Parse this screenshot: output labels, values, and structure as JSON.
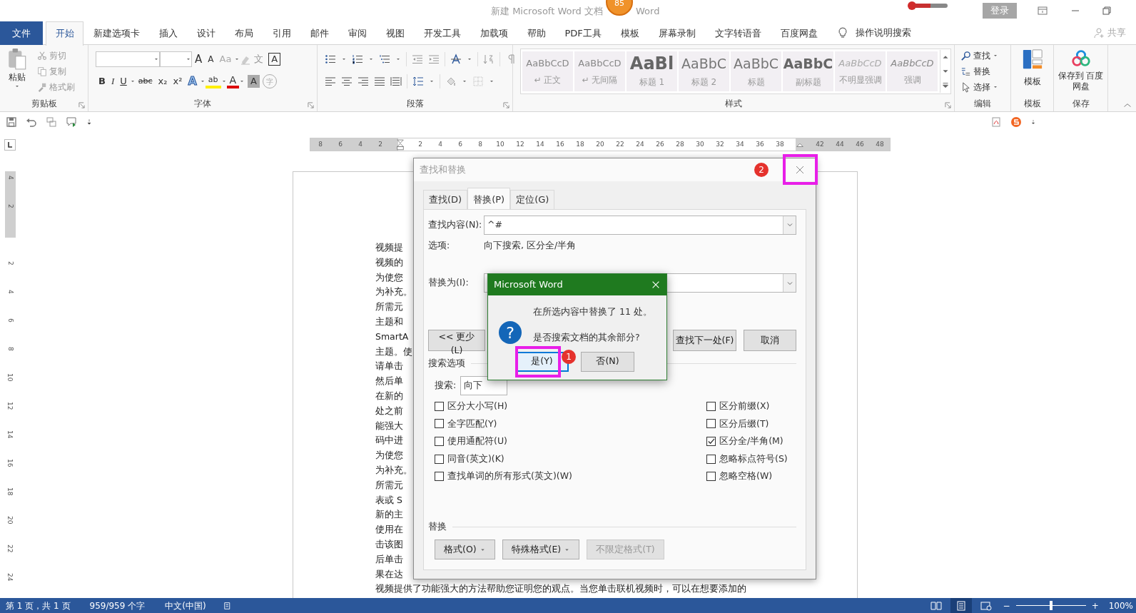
{
  "title_bar": {
    "title_left": "新建 Microsoft Word 文档",
    "badge": "85",
    "title_right": "Word",
    "login": "登录"
  },
  "ribbon_tabs": [
    {
      "label": "文件",
      "kind": "file",
      "selected": false
    },
    {
      "label": "开始",
      "kind": "tab",
      "selected": true
    },
    {
      "label": "新建选项卡",
      "kind": "tab",
      "selected": false
    },
    {
      "label": "插入",
      "kind": "tab",
      "selected": false
    },
    {
      "label": "设计",
      "kind": "tab",
      "selected": false
    },
    {
      "label": "布局",
      "kind": "tab",
      "selected": false
    },
    {
      "label": "引用",
      "kind": "tab",
      "selected": false
    },
    {
      "label": "邮件",
      "kind": "tab",
      "selected": false
    },
    {
      "label": "审阅",
      "kind": "tab",
      "selected": false
    },
    {
      "label": "视图",
      "kind": "tab",
      "selected": false
    },
    {
      "label": "开发工具",
      "kind": "tab",
      "selected": false
    },
    {
      "label": "加载项",
      "kind": "tab",
      "selected": false
    },
    {
      "label": "帮助",
      "kind": "tab",
      "selected": false
    },
    {
      "label": "PDF工具",
      "kind": "tab",
      "selected": false
    },
    {
      "label": "模板",
      "kind": "tab",
      "selected": false
    },
    {
      "label": "屏幕录制",
      "kind": "tab",
      "selected": false
    },
    {
      "label": "文字转语音",
      "kind": "tab",
      "selected": false
    },
    {
      "label": "百度网盘",
      "kind": "tab",
      "selected": false
    }
  ],
  "tell_me": "操作说明搜索",
  "share": "共享",
  "clipboard": {
    "title": "剪贴板",
    "paste": "粘贴",
    "items": [
      "剪切",
      "复制",
      "格式刷"
    ]
  },
  "font": {
    "title": "字体",
    "row1": [
      "A",
      "A",
      "Aa",
      "文",
      "A"
    ],
    "row2": [
      "B",
      "I",
      "U",
      "abc",
      "x₂",
      "x²",
      "A",
      "ab",
      "A",
      "A",
      "字"
    ]
  },
  "paragraph": {
    "title": "段落"
  },
  "styles": {
    "title": "样式",
    "items": [
      {
        "preview": "AaBbCcD",
        "label": "↵ 正文"
      },
      {
        "preview": "AaBbCcD",
        "label": "↵ 无间隔"
      },
      {
        "preview": "AaBl",
        "label": "标题 1"
      },
      {
        "preview": "AaBbC",
        "label": "标题 2"
      },
      {
        "preview": "AaBbC",
        "label": "标题"
      },
      {
        "preview": "AaBbC",
        "label": "副标题"
      },
      {
        "preview": "AaBbCcD",
        "label": "不明显强调"
      },
      {
        "preview": "AaBbCcD",
        "label": "强调"
      }
    ]
  },
  "editing": {
    "title": "编辑",
    "items": [
      "查找",
      "替换",
      "选择"
    ]
  },
  "templates": {
    "title": "模板",
    "label": "模板"
  },
  "save": {
    "title": "保存",
    "label": "保存到 百度网盘"
  },
  "ruler_numbers": [
    "8",
    "6",
    "4",
    "2",
    "2",
    "4",
    "6",
    "8",
    "10",
    "12",
    "14",
    "16",
    "18",
    "20",
    "22",
    "24",
    "26",
    "28",
    "30",
    "32",
    "34",
    "36",
    "38",
    "42",
    "44",
    "46",
    "48"
  ],
  "vruler_numbers": [
    "4",
    "2",
    "2",
    "4",
    "6",
    "8",
    "10",
    "12",
    "14",
    "16",
    "18",
    "20",
    "22",
    "24"
  ],
  "document": {
    "lines": [
      "视频提",
      "视频的",
      "为使您",
      "为补充。",
      "所需元",
      "主题和",
      "SmartA",
      "主题。使",
      "请单击",
      "然后单",
      "在新的",
      "处之前",
      "能强大",
      "码中进",
      "为使您",
      "为补充。",
      "所需元",
      "表或 S",
      "新的主",
      "使用在",
      "击该图",
      "后单击",
      "果在达",
      "视频提供了功能强大的方法帮助您证明您的观点。当您单击联机视频时，可以在想要添加的"
    ]
  },
  "find_replace": {
    "title": "查找和替换",
    "tabs": [
      {
        "label": "查找(D)",
        "selected": false
      },
      {
        "label": "替换(P)",
        "selected": true
      },
      {
        "label": "定位(G)",
        "selected": false
      }
    ],
    "find_label": "查找内容(N):",
    "find_value": "^#",
    "options_label": "选项:",
    "options_value": "向下搜索, 区分全/半角",
    "replace_label": "替换为(I):",
    "buttons": [
      "<< 更少(L)",
      "查找下一处(F)",
      "取消"
    ],
    "search_options_title": "搜索选项",
    "search_label": "搜索:",
    "search_value": "向下",
    "checks_left": [
      {
        "label": "区分大小写(H)",
        "checked": false
      },
      {
        "label": "全字匹配(Y)",
        "checked": false
      },
      {
        "label": "使用通配符(U)",
        "checked": false
      },
      {
        "label": "同音(英文)(K)",
        "checked": false
      },
      {
        "label": "查找单词的所有形式(英文)(W)",
        "checked": false
      }
    ],
    "checks_right": [
      {
        "label": "区分前缀(X)",
        "checked": false
      },
      {
        "label": "区分后缀(T)",
        "checked": false
      },
      {
        "label": "区分全/半角(M)",
        "checked": true
      },
      {
        "label": "忽略标点符号(S)",
        "checked": false
      },
      {
        "label": "忽略空格(W)",
        "checked": false
      }
    ],
    "replace_section": "替换",
    "format_buttons": [
      {
        "label": "格式(O)",
        "dropdown": true,
        "disabled": false
      },
      {
        "label": "特殊格式(E)",
        "dropdown": true,
        "disabled": false
      },
      {
        "label": "不限定格式(T)",
        "dropdown": false,
        "disabled": true
      }
    ]
  },
  "message_box": {
    "title": "Microsoft Word",
    "icon": "?",
    "lines": [
      "在所选内容中替换了 11 处。",
      "是否搜索文档的其余部分?"
    ],
    "buttons": [
      {
        "label": "是(Y)",
        "selected": true
      },
      {
        "label": "否(N)",
        "selected": false
      }
    ]
  },
  "callouts": [
    "1",
    "2"
  ],
  "status_bar": {
    "items": [
      "第 1 页，共 1 页",
      "959/959 个字",
      "中文(中国)"
    ],
    "zoom": "100%",
    "zoom_out": "−",
    "zoom_in": "+",
    "zoom_level": {
      "level": 0.5
    }
  }
}
